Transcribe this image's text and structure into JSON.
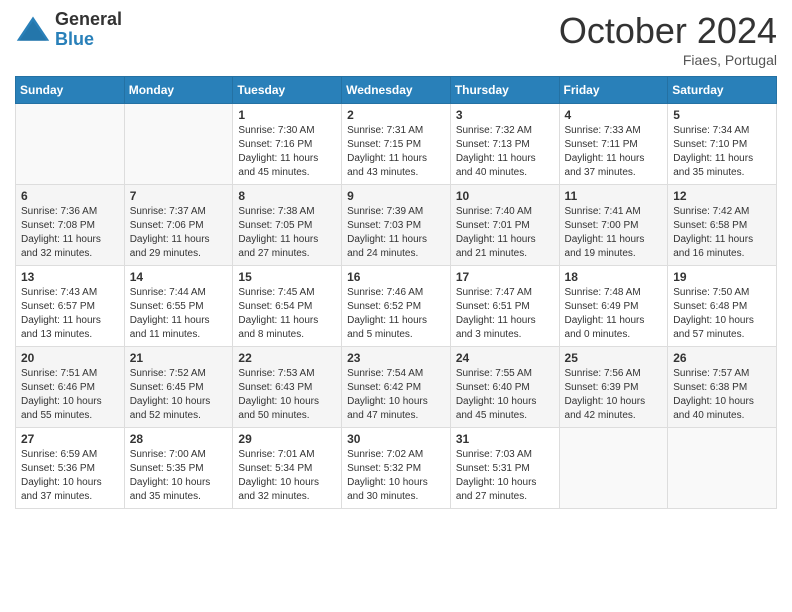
{
  "header": {
    "logo_general": "General",
    "logo_blue": "Blue",
    "month_title": "October 2024",
    "subtitle": "Fiaes, Portugal"
  },
  "days_of_week": [
    "Sunday",
    "Monday",
    "Tuesday",
    "Wednesday",
    "Thursday",
    "Friday",
    "Saturday"
  ],
  "weeks": [
    [
      {
        "day": "",
        "info": ""
      },
      {
        "day": "",
        "info": ""
      },
      {
        "day": "1",
        "info": "Sunrise: 7:30 AM\nSunset: 7:16 PM\nDaylight: 11 hours and 45 minutes."
      },
      {
        "day": "2",
        "info": "Sunrise: 7:31 AM\nSunset: 7:15 PM\nDaylight: 11 hours and 43 minutes."
      },
      {
        "day": "3",
        "info": "Sunrise: 7:32 AM\nSunset: 7:13 PM\nDaylight: 11 hours and 40 minutes."
      },
      {
        "day": "4",
        "info": "Sunrise: 7:33 AM\nSunset: 7:11 PM\nDaylight: 11 hours and 37 minutes."
      },
      {
        "day": "5",
        "info": "Sunrise: 7:34 AM\nSunset: 7:10 PM\nDaylight: 11 hours and 35 minutes."
      }
    ],
    [
      {
        "day": "6",
        "info": "Sunrise: 7:36 AM\nSunset: 7:08 PM\nDaylight: 11 hours and 32 minutes."
      },
      {
        "day": "7",
        "info": "Sunrise: 7:37 AM\nSunset: 7:06 PM\nDaylight: 11 hours and 29 minutes."
      },
      {
        "day": "8",
        "info": "Sunrise: 7:38 AM\nSunset: 7:05 PM\nDaylight: 11 hours and 27 minutes."
      },
      {
        "day": "9",
        "info": "Sunrise: 7:39 AM\nSunset: 7:03 PM\nDaylight: 11 hours and 24 minutes."
      },
      {
        "day": "10",
        "info": "Sunrise: 7:40 AM\nSunset: 7:01 PM\nDaylight: 11 hours and 21 minutes."
      },
      {
        "day": "11",
        "info": "Sunrise: 7:41 AM\nSunset: 7:00 PM\nDaylight: 11 hours and 19 minutes."
      },
      {
        "day": "12",
        "info": "Sunrise: 7:42 AM\nSunset: 6:58 PM\nDaylight: 11 hours and 16 minutes."
      }
    ],
    [
      {
        "day": "13",
        "info": "Sunrise: 7:43 AM\nSunset: 6:57 PM\nDaylight: 11 hours and 13 minutes."
      },
      {
        "day": "14",
        "info": "Sunrise: 7:44 AM\nSunset: 6:55 PM\nDaylight: 11 hours and 11 minutes."
      },
      {
        "day": "15",
        "info": "Sunrise: 7:45 AM\nSunset: 6:54 PM\nDaylight: 11 hours and 8 minutes."
      },
      {
        "day": "16",
        "info": "Sunrise: 7:46 AM\nSunset: 6:52 PM\nDaylight: 11 hours and 5 minutes."
      },
      {
        "day": "17",
        "info": "Sunrise: 7:47 AM\nSunset: 6:51 PM\nDaylight: 11 hours and 3 minutes."
      },
      {
        "day": "18",
        "info": "Sunrise: 7:48 AM\nSunset: 6:49 PM\nDaylight: 11 hours and 0 minutes."
      },
      {
        "day": "19",
        "info": "Sunrise: 7:50 AM\nSunset: 6:48 PM\nDaylight: 10 hours and 57 minutes."
      }
    ],
    [
      {
        "day": "20",
        "info": "Sunrise: 7:51 AM\nSunset: 6:46 PM\nDaylight: 10 hours and 55 minutes."
      },
      {
        "day": "21",
        "info": "Sunrise: 7:52 AM\nSunset: 6:45 PM\nDaylight: 10 hours and 52 minutes."
      },
      {
        "day": "22",
        "info": "Sunrise: 7:53 AM\nSunset: 6:43 PM\nDaylight: 10 hours and 50 minutes."
      },
      {
        "day": "23",
        "info": "Sunrise: 7:54 AM\nSunset: 6:42 PM\nDaylight: 10 hours and 47 minutes."
      },
      {
        "day": "24",
        "info": "Sunrise: 7:55 AM\nSunset: 6:40 PM\nDaylight: 10 hours and 45 minutes."
      },
      {
        "day": "25",
        "info": "Sunrise: 7:56 AM\nSunset: 6:39 PM\nDaylight: 10 hours and 42 minutes."
      },
      {
        "day": "26",
        "info": "Sunrise: 7:57 AM\nSunset: 6:38 PM\nDaylight: 10 hours and 40 minutes."
      }
    ],
    [
      {
        "day": "27",
        "info": "Sunrise: 6:59 AM\nSunset: 5:36 PM\nDaylight: 10 hours and 37 minutes."
      },
      {
        "day": "28",
        "info": "Sunrise: 7:00 AM\nSunset: 5:35 PM\nDaylight: 10 hours and 35 minutes."
      },
      {
        "day": "29",
        "info": "Sunrise: 7:01 AM\nSunset: 5:34 PM\nDaylight: 10 hours and 32 minutes."
      },
      {
        "day": "30",
        "info": "Sunrise: 7:02 AM\nSunset: 5:32 PM\nDaylight: 10 hours and 30 minutes."
      },
      {
        "day": "31",
        "info": "Sunrise: 7:03 AM\nSunset: 5:31 PM\nDaylight: 10 hours and 27 minutes."
      },
      {
        "day": "",
        "info": ""
      },
      {
        "day": "",
        "info": ""
      }
    ]
  ]
}
